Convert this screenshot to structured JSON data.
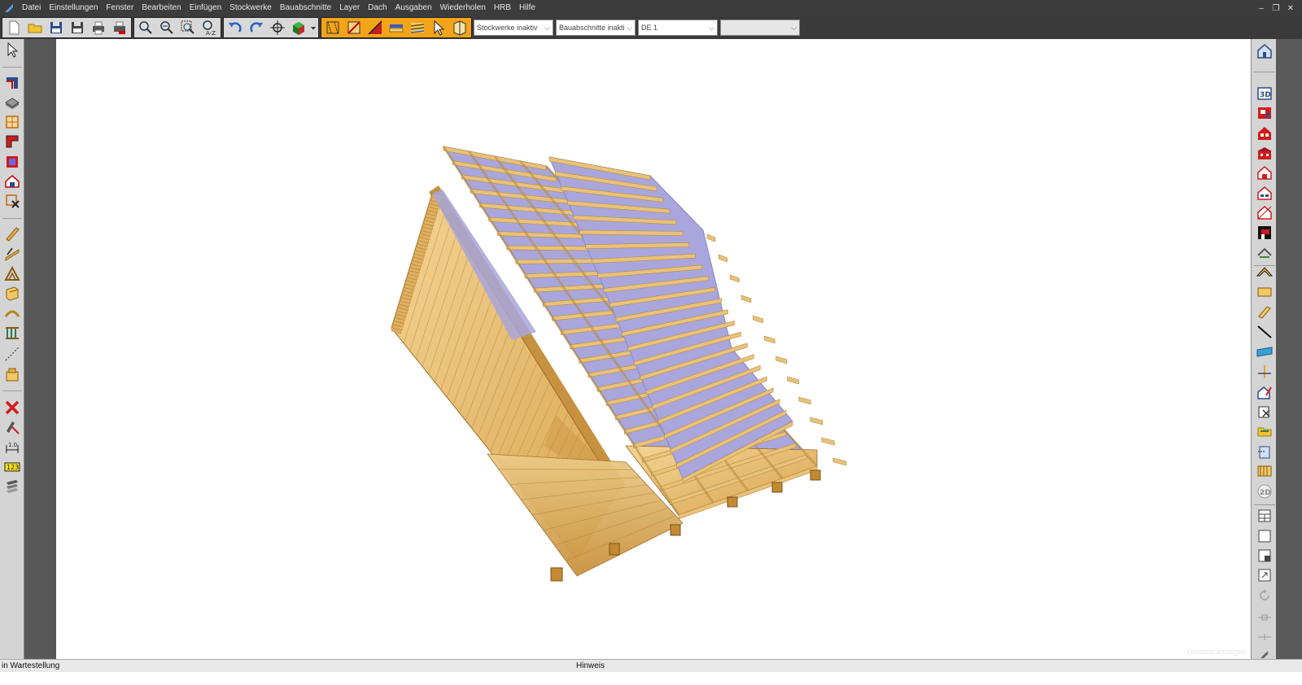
{
  "menu": {
    "items": [
      "Datei",
      "Einstellungen",
      "Fenster",
      "Bearbeiten",
      "Einfügen",
      "Stockwerke",
      "Bauabschnitte",
      "Layer",
      "Dach",
      "Ausgaben",
      "Wiederholen",
      "HRB",
      "Hilfe"
    ]
  },
  "toolbar": {
    "floors_select": "Stockwerke inaktiv",
    "sections_select": "Bauabschnitte inakti",
    "layer_select": "DE 1",
    "extra_select": ""
  },
  "icons": {
    "menubar": [
      "app-logo-icon",
      "minimize-icon",
      "restore-icon",
      "close-icon"
    ],
    "toolbar_file": [
      "new-file-icon",
      "open-folder-icon",
      "save-icon",
      "save-all-icon",
      "print-icon",
      "print-preview-icon"
    ],
    "toolbar_view": [
      "zoom-in-icon",
      "zoom-out-icon",
      "zoom-window-icon",
      "zoom-text-icon"
    ],
    "toolbar_edit": [
      "undo-icon",
      "redo-icon",
      "crosshair-icon",
      "3d-cube-icon",
      "dropdown-arrow-icon"
    ],
    "toolbar_roof": [
      "roof-select-icon",
      "roof-edit-icon",
      "roof-red-icon",
      "roof-layers-icon",
      "roof-battens-icon",
      "pointer-icon",
      "book-icon"
    ]
  },
  "canvas": {
    "watermark": "Desktop anzeigen"
  },
  "statusbar": {
    "left": "in Wartestellung",
    "center": "Hinweis"
  },
  "colors": {
    "wood": "#e8c27a",
    "wood_dark": "#b98a3e",
    "membrane": "#a8a6dc",
    "toolbar_orange": "#f4a418",
    "menubar": "#3c3c3c"
  }
}
